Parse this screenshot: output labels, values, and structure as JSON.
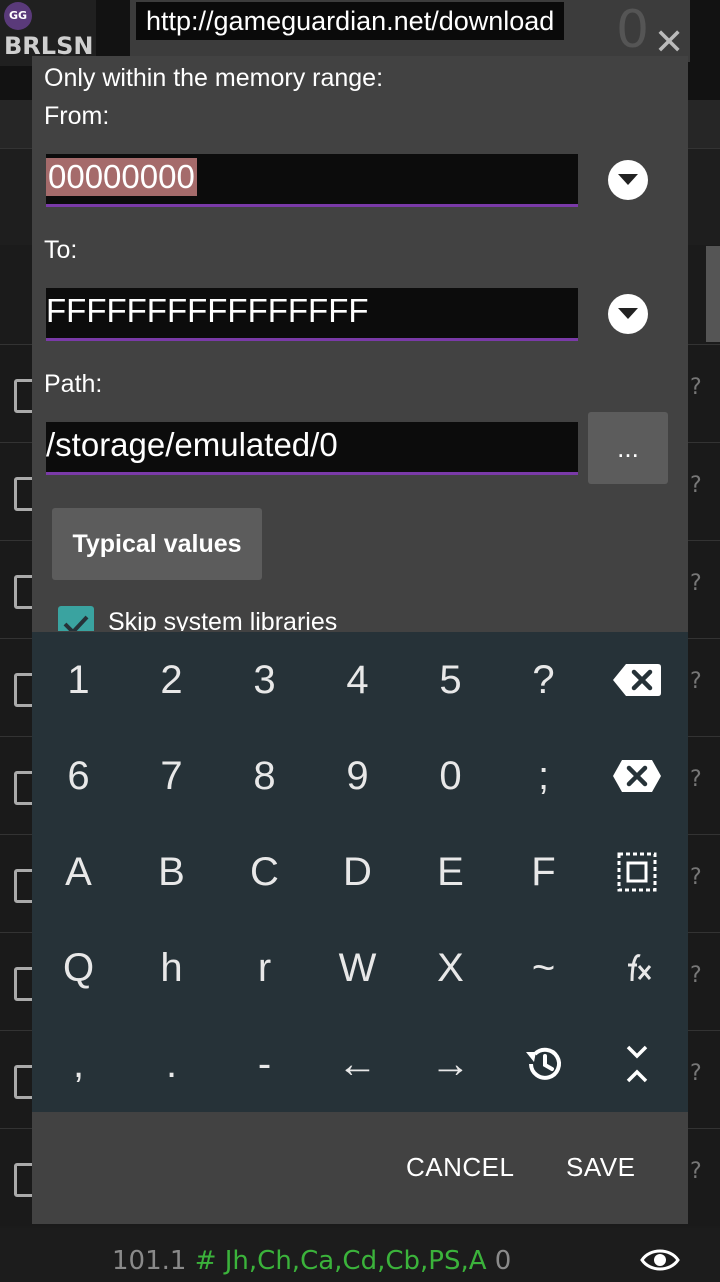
{
  "banner": {
    "url": "http://gameguardian.net/download"
  },
  "background": {
    "logo_badge": "GG",
    "logo_text": "BRLSN",
    "status_number": "101.1",
    "status_hash": "#",
    "status_regions": "Jh,Ch,Ca,Cd,Cb,PS,A",
    "status_count": "0",
    "row_marker": "?"
  },
  "dialog": {
    "title": "Only within the memory range:",
    "from_label": "From:",
    "from_value": "00000000",
    "to_label": "To:",
    "to_value": "FFFFFFFFFFFFFFFF",
    "path_label": "Path:",
    "path_value": "/storage/emulated/0",
    "browse_label": "...",
    "typical_label": "Typical values",
    "skip_label": "Skip system libraries",
    "skip_checked": true,
    "cancel_label": "CANCEL",
    "save_label": "SAVE"
  },
  "keyboard": {
    "rows": [
      [
        "1",
        "2",
        "3",
        "4",
        "5",
        "?"
      ],
      [
        "6",
        "7",
        "8",
        "9",
        "0",
        ";"
      ],
      [
        "A",
        "B",
        "C",
        "D",
        "E",
        "F"
      ],
      [
        "Q",
        "h",
        "r",
        "W",
        "X",
        "~"
      ],
      [
        ",",
        ".",
        "-",
        "←",
        "→"
      ]
    ],
    "special_keys": [
      "backspace-icon",
      "clear-icon",
      "select-all-icon",
      "fx-icon",
      "history-icon",
      "collapse-icon"
    ]
  },
  "colors": {
    "dialog_bg": "#424242",
    "keyboard_bg": "#263238",
    "field_underline": "#7a3aa8",
    "selection": "#a56b6b",
    "checkbox": "#3aa3a0",
    "status_green": "#3bb33b"
  }
}
